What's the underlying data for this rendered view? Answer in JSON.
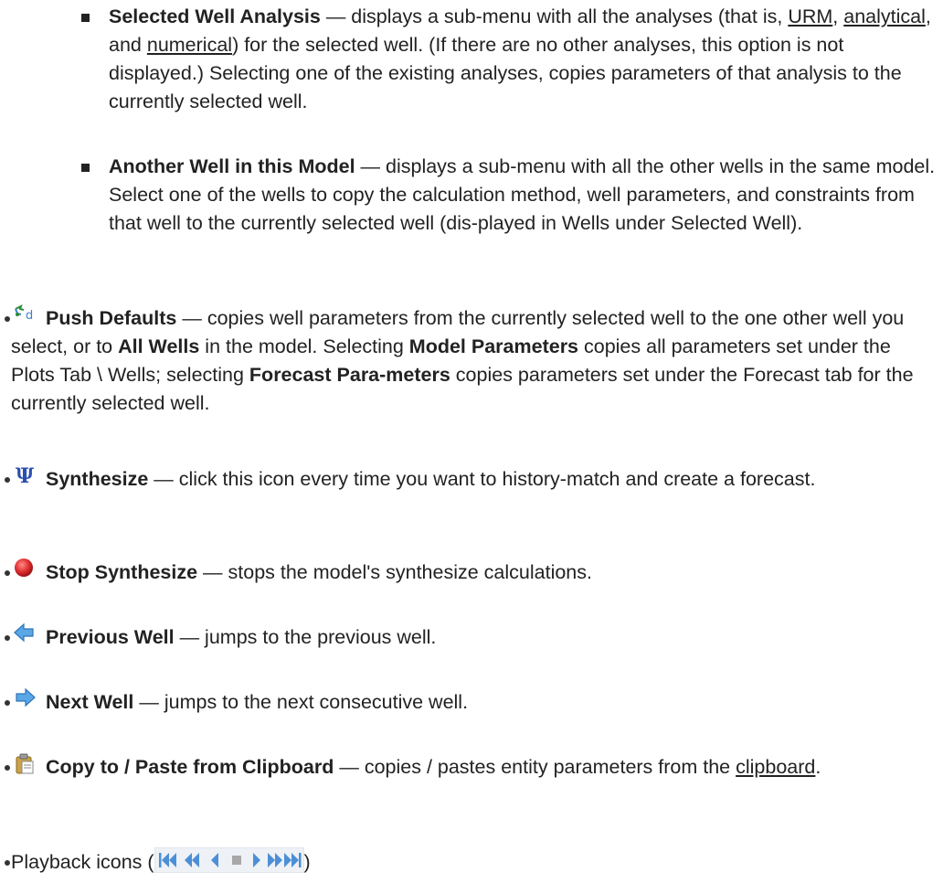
{
  "sub_items": [
    {
      "title": "Selected Well Analysis",
      "text1": " — displays a sub-menu with all the analyses (that is, ",
      "link1": "URM",
      "sep1": ", ",
      "link2": "analytical",
      "sep2": ", and ",
      "link3": "numerical",
      "text2": ") for the selected well. (If there are no other analyses, this option is not displayed.) Selecting one of the existing analyses, copies parameters of that analysis to the currently selected well."
    },
    {
      "title": "Another Well in this Model",
      "text": " — displays a sub-menu with all the other wells in the same model. Select one of the wells to copy the calculation method, well parameters, and constraints from that well to the currently selected well (dis-played in Wells under Selected Well)."
    }
  ],
  "items": {
    "push_defaults": {
      "icon": "push-defaults-icon",
      "title": "Push Defaults",
      "text1": " — copies well parameters from the currently selected well to the one other well you select, or to ",
      "bold1": "All Wells",
      "text2": " in the model. Selecting ",
      "bold2": "Model Parameters",
      "text3": " copies all parameters set under the Plots Tab \\ Wells; selecting ",
      "bold3": "Forecast Para-meters",
      "text4": " copies parameters set under the Forecast tab for the currently selected well."
    },
    "synthesize": {
      "icon": "synthesize-icon",
      "title": "Synthesize",
      "text": " — click this icon every time you want to history-match and create a forecast."
    },
    "stop_synthesize": {
      "icon": "stop-icon",
      "title": "Stop Synthesize",
      "text": " — stops the model's synthesize calculations."
    },
    "previous_well": {
      "icon": "arrow-left-icon",
      "title": "Previous Well",
      "text": " — jumps to the previous well."
    },
    "next_well": {
      "icon": "arrow-right-icon",
      "title": "Next Well",
      "text": " — jumps to the next consecutive well."
    },
    "clipboard": {
      "icon": "clipboard-icon",
      "title": "Copy to / Paste from Clipboard",
      "text1": " — copies / pastes entity parameters from the ",
      "link": "clipboard",
      "text2": "."
    },
    "playback": {
      "text1": "Playback icons (",
      "text2": ")",
      "icons": [
        "skip-to-start-icon",
        "fast-rewind-icon",
        "step-back-icon",
        "stop-square-icon",
        "play-icon",
        "fast-forward-icon",
        "skip-to-end-icon"
      ]
    }
  },
  "colors": {
    "text": "#222222",
    "icon_blue": "#3b82c4",
    "stop_red": "#d9262c",
    "synth_blue": "#2a4fb0"
  }
}
